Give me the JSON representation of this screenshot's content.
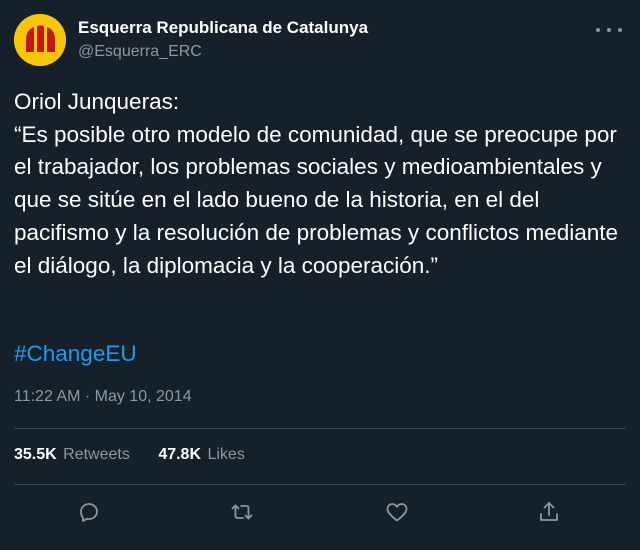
{
  "account": {
    "name": "Esquerra Republicana de Catalunya",
    "handle": "@Esquerra_ERC",
    "avatar_colors": {
      "background": "#f7c50b",
      "stripes": "#c4161c"
    }
  },
  "tweet": {
    "text": "Oriol Junqueras:\n“Es posible otro modelo de comunidad, que se preocupe por el trabajador, los problemas sociales y medioambientales y que se sitúe en el lado bueno de la historia, en el del pacifismo y la resolución de problemas y conflictos mediante el diálogo, la diplomacia y la cooperación.”",
    "hashtag": "#ChangeEU",
    "timestamp": "11:22 AM · May 10, 2014"
  },
  "stats": {
    "retweets_count": "35.5K",
    "retweets_label": "Retweets",
    "likes_count": "47.8K",
    "likes_label": "Likes"
  },
  "actions": [
    "reply-icon",
    "retweet-icon",
    "like-icon",
    "share-icon"
  ],
  "colors": {
    "background": "#15202b",
    "text": "#ffffff",
    "secondary": "#8899a6",
    "link": "#1d9bf0",
    "divider": "#38444d"
  }
}
